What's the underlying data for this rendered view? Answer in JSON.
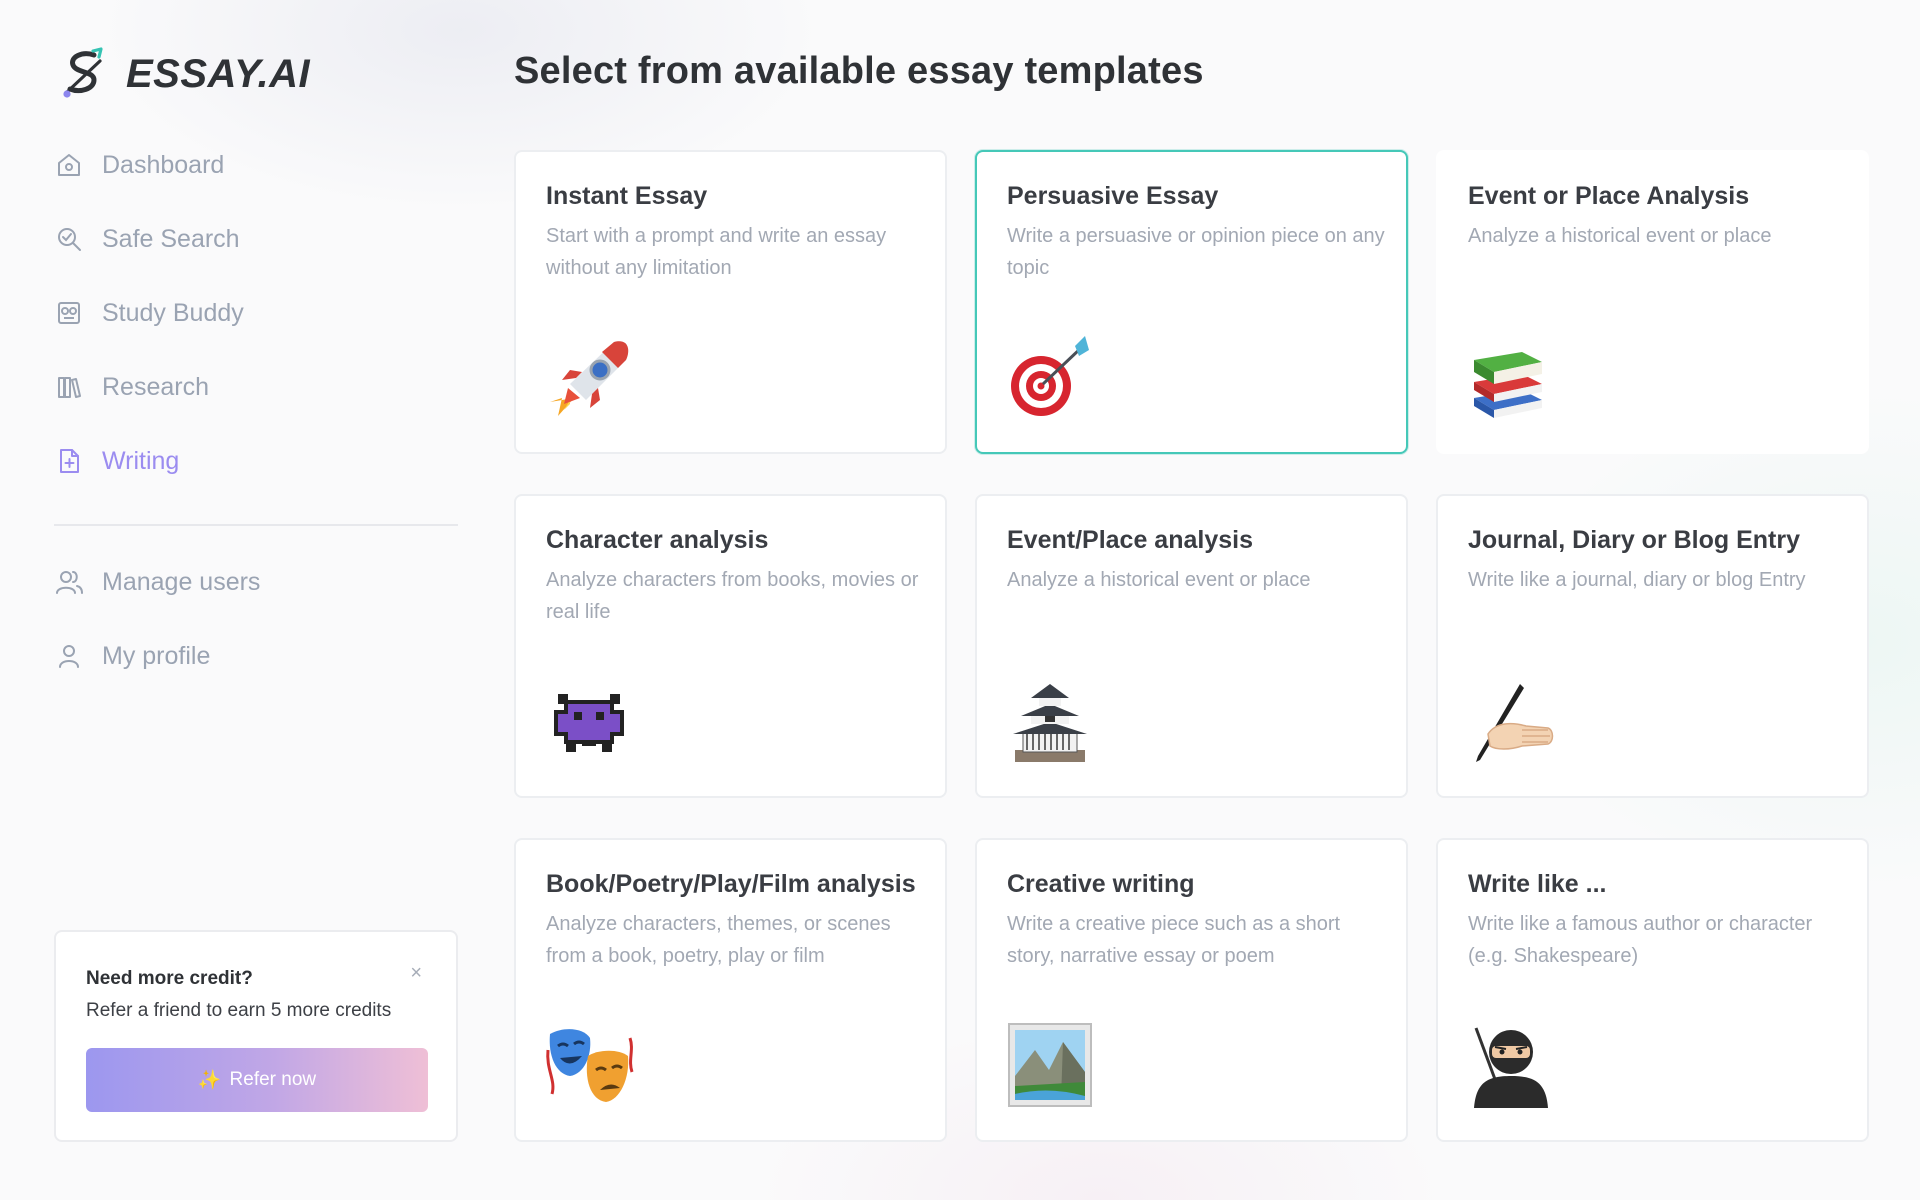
{
  "app": {
    "name": "ESSAY.AI"
  },
  "sidebar": {
    "items": [
      {
        "label": "Dashboard",
        "icon": "home-icon",
        "active": false
      },
      {
        "label": "Safe Search",
        "icon": "search-icon",
        "active": false
      },
      {
        "label": "Study Buddy",
        "icon": "study-buddy-icon",
        "active": false
      },
      {
        "label": "Research",
        "icon": "books-icon",
        "active": false
      },
      {
        "label": "Writing",
        "icon": "file-plus-icon",
        "active": true
      }
    ],
    "secondary_items": [
      {
        "label": "Manage users",
        "icon": "users-icon"
      },
      {
        "label": "My profile",
        "icon": "user-icon"
      }
    ]
  },
  "credit_card": {
    "title": "Need more credit?",
    "text": "Refer a friend to earn 5 more credits",
    "button_label": "Refer now",
    "close_glyph": "×"
  },
  "main": {
    "title": "Select from available essay templates",
    "templates": [
      {
        "title": "Instant Essay",
        "description": "Start with a prompt and write an essay without any limitation",
        "icon": "rocket-icon",
        "selected": false
      },
      {
        "title": "Persuasive Essay",
        "description": "Write a persuasive or opinion piece on any topic",
        "icon": "target-icon",
        "selected": true
      },
      {
        "title": "Event or Place Analysis",
        "description": "Analyze a historical event or place",
        "icon": "books-stack-icon",
        "selected": false
      },
      {
        "title": "Character analysis",
        "description": "Analyze characters from books, movies or real life",
        "icon": "pixel-monster-icon",
        "selected": false
      },
      {
        "title": "Event/Place analysis",
        "description": "Analyze a historical event or place",
        "icon": "castle-icon",
        "selected": false
      },
      {
        "title": "Journal, Diary or Blog Entry",
        "description": "Write like a journal, diary or blog Entry",
        "icon": "writing-hand-icon",
        "selected": false
      },
      {
        "title": "Book/Poetry/Play/Film analysis",
        "description": "Analyze characters, themes, or scenes from a book, poetry, play or film",
        "icon": "theater-masks-icon",
        "selected": false
      },
      {
        "title": "Creative writing",
        "description": "Write a creative piece such as a short story, narrative essay or poem",
        "icon": "landscape-picture-icon",
        "selected": false
      },
      {
        "title": "Write like ...",
        "description": "Write like a famous author or character (e.g. Shakespeare)",
        "icon": "ninja-icon",
        "selected": false
      }
    ]
  },
  "colors": {
    "accent": "#9b8cf0",
    "selected_border": "#45c8b8",
    "nav_text": "#9aa3b2",
    "description_text": "#a2a8b3"
  }
}
